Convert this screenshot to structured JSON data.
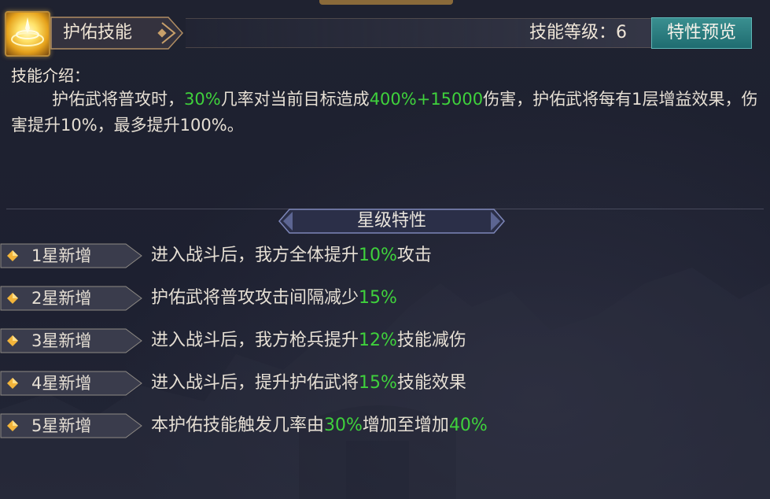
{
  "header": {
    "skill_name": "护佑技能",
    "level_text": "技能等级：6",
    "preview_button": "特性预览"
  },
  "intro": {
    "title": "技能介绍：",
    "segments": [
      {
        "text": "护佑武将普攻时，",
        "highlight": false
      },
      {
        "text": "30%",
        "highlight": true
      },
      {
        "text": "几率对当前目标造成",
        "highlight": false
      },
      {
        "text": "400%+15000",
        "highlight": true
      },
      {
        "text": "伤害，护佑武将每有1层增益效果，伤害提升10%，最多提升100%。",
        "highlight": false
      }
    ]
  },
  "star_section": {
    "title": "星级特性",
    "rows": [
      {
        "label": "1星新增",
        "segments": [
          {
            "text": "进入战斗后，我方全体提升",
            "highlight": false
          },
          {
            "text": "10%",
            "highlight": true
          },
          {
            "text": "攻击",
            "highlight": false
          }
        ]
      },
      {
        "label": "2星新增",
        "segments": [
          {
            "text": "护佑武将普攻攻击间隔减少",
            "highlight": false
          },
          {
            "text": "15%",
            "highlight": true
          }
        ]
      },
      {
        "label": "3星新增",
        "segments": [
          {
            "text": "进入战斗后，我方枪兵提升",
            "highlight": false
          },
          {
            "text": "12%",
            "highlight": true
          },
          {
            "text": "技能减伤",
            "highlight": false
          }
        ]
      },
      {
        "label": "4星新增",
        "segments": [
          {
            "text": "进入战斗后，提升护佑武将",
            "highlight": false
          },
          {
            "text": "15%",
            "highlight": true
          },
          {
            "text": "技能效果",
            "highlight": false
          }
        ]
      },
      {
        "label": "5星新增",
        "segments": [
          {
            "text": "本护佑技能触发几率由",
            "highlight": false
          },
          {
            "text": "30%",
            "highlight": true
          },
          {
            "text": "增加至增加",
            "highlight": false
          },
          {
            "text": "40%",
            "highlight": true
          }
        ]
      }
    ]
  },
  "icons": {
    "skill_icon": "golden-shield-skill-icon",
    "row_marker": "gold-diamond-icon"
  },
  "colors": {
    "highlight": "#3fd13c",
    "button": "#2a7f82",
    "text": "#e6dfd4"
  }
}
